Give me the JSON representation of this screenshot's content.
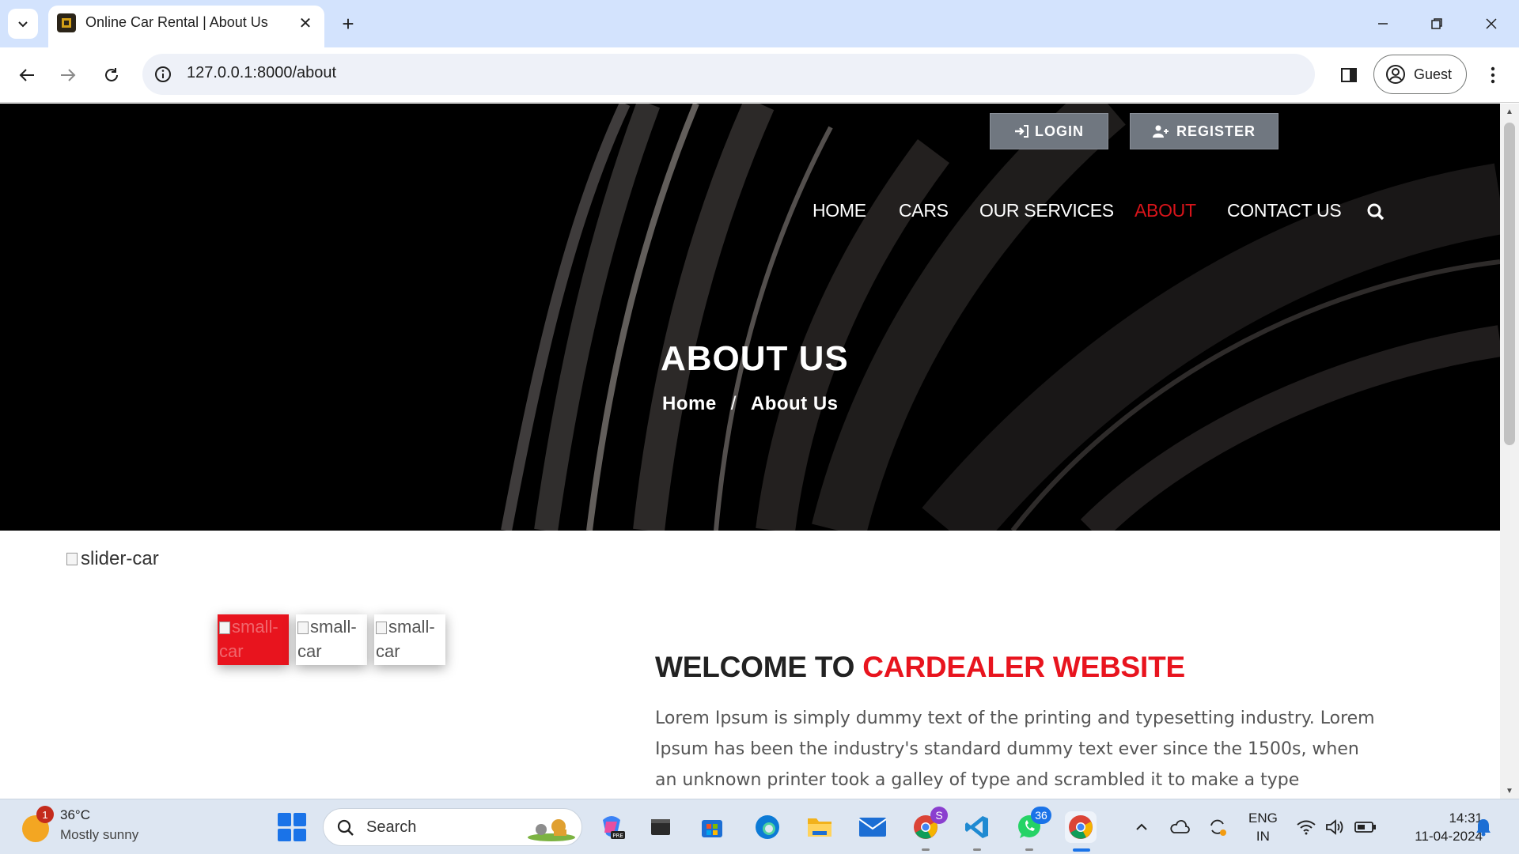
{
  "browser": {
    "tab_title": "Online Car Rental | About Us",
    "url": "127.0.0.1:8000/about",
    "profile_label": "Guest"
  },
  "site": {
    "auth": {
      "login": "LOGIN",
      "register": "REGISTER"
    },
    "nav": [
      {
        "label": "HOME",
        "active": false
      },
      {
        "label": "CARS",
        "active": false
      },
      {
        "label": "OUR SERVICES",
        "active": false
      },
      {
        "label": "ABOUT",
        "active": true
      },
      {
        "label": "CONTACT US",
        "active": false
      }
    ],
    "hero": {
      "title": "ABOUT US",
      "breadcrumb": {
        "home": "Home",
        "separator": "/",
        "current": "About Us"
      }
    },
    "gallery": {
      "main_alt": "slider-car",
      "thumbs": [
        "small-car",
        "small-car",
        "small-car"
      ]
    },
    "welcome": {
      "prefix": "WELCOME TO ",
      "highlight": "CARDEALER WEBSITE",
      "body": "Lorem Ipsum is simply dummy text of the printing and typesetting industry. Lorem Ipsum has been the industry's standard dummy text ever since the 1500s, when an unknown printer took a galley of type and scrambled it to make a type specimen book."
    },
    "colors": {
      "accent": "#e8141e",
      "button": "#707780"
    }
  },
  "taskbar": {
    "weather": {
      "temp": "36°C",
      "desc": "Mostly sunny",
      "badge": "1"
    },
    "search_placeholder": "Search",
    "apps": [
      {
        "name": "copilot",
        "badge": ""
      },
      {
        "name": "terminal",
        "badge": ""
      },
      {
        "name": "microsoft-store",
        "badge": ""
      },
      {
        "name": "edge",
        "badge": ""
      },
      {
        "name": "file-explorer",
        "badge": ""
      },
      {
        "name": "mail",
        "badge": ""
      },
      {
        "name": "chrome-profile",
        "badge": "S"
      },
      {
        "name": "vscode",
        "badge": ""
      },
      {
        "name": "whatsapp",
        "badge": "36"
      },
      {
        "name": "chrome",
        "badge": ""
      }
    ],
    "lang": {
      "line1": "ENG",
      "line2": "IN"
    },
    "clock": {
      "time": "14:31",
      "date": "11-04-2024"
    }
  }
}
